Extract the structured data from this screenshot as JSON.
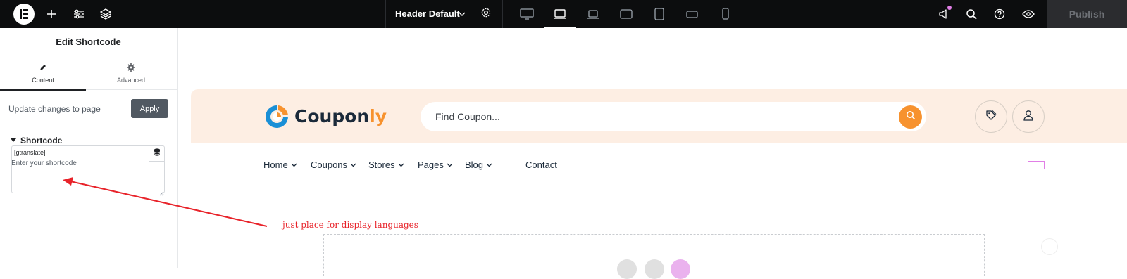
{
  "topbar": {
    "document_title": "Header Default",
    "publish_label": "Publish",
    "icons": [
      "elementor-logo",
      "plus-icon",
      "sliders-icon",
      "layers-icon",
      "chevron-down-icon",
      "gear-icon",
      "desktop-icon",
      "laptop-icon",
      "laptop-small-icon",
      "tablet-landscape-icon",
      "tablet-portrait-icon",
      "mobile-landscape-icon",
      "mobile-portrait-icon",
      "megaphone-icon",
      "search-icon",
      "help-icon",
      "eye-icon"
    ]
  },
  "panel": {
    "title": "Edit Shortcode",
    "tabs": [
      {
        "label": "Content",
        "icon": "pencil-icon",
        "active": true
      },
      {
        "label": "Advanced",
        "icon": "gear-icon",
        "active": false
      }
    ],
    "update_text": "Update changes to page",
    "apply_label": "Apply",
    "section_title": "Shortcode",
    "field_label": "Enter your shortcode",
    "shortcode_value": "[gtranslate]"
  },
  "canvas": {
    "brand_main": "Coupon",
    "brand_accent": "ly",
    "search_placeholder": "Find Coupon...",
    "nav": [
      {
        "label": "Home",
        "has_dropdown": true
      },
      {
        "label": "Coupons",
        "has_dropdown": true
      },
      {
        "label": "Stores",
        "has_dropdown": true
      },
      {
        "label": "Pages",
        "has_dropdown": true
      },
      {
        "label": "Blog",
        "has_dropdown": true
      },
      {
        "label": "Contact",
        "has_dropdown": false
      }
    ],
    "colors": {
      "header_bg": "#fdeee3",
      "accent": "#f7922e",
      "brand_dark": "#1b2a3a"
    }
  },
  "annotation": {
    "text": "just place for display languages",
    "color": "#e8232a"
  }
}
